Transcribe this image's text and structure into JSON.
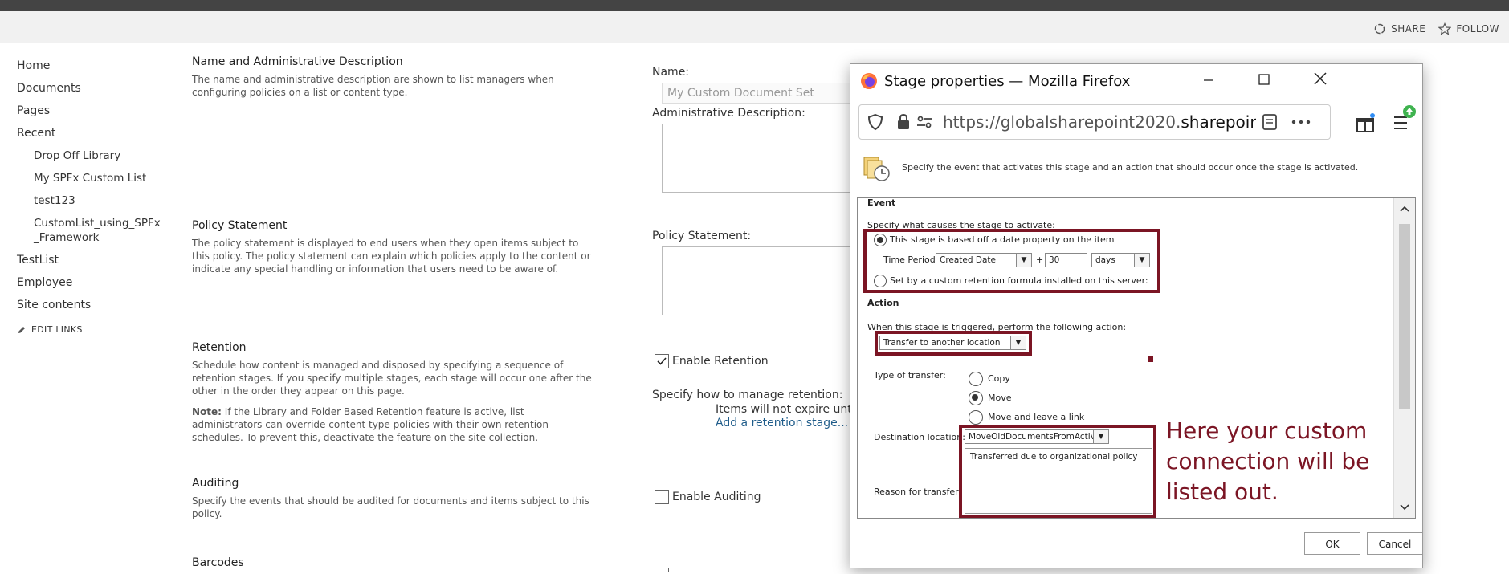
{
  "ribbon": {
    "share": "SHARE",
    "follow": "FOLLOW"
  },
  "nav": {
    "items": [
      "Home",
      "Documents",
      "Pages",
      "Recent"
    ],
    "recent": [
      "Drop Off Library",
      "My SPFx Custom List",
      "test123",
      "CustomList_using_SPFx\n_Framework"
    ],
    "more": [
      "TestList",
      "Employee",
      "Site contents"
    ],
    "edit_links": "EDIT LINKS"
  },
  "sections": {
    "name": {
      "title": "Name and Administrative Description",
      "desc": "The name and administrative description are shown to list managers when configuring policies on a list or content type."
    },
    "policy": {
      "title": "Policy Statement",
      "desc": "The policy statement is displayed to end users when they open items subject to this policy. The policy statement can explain which policies apply to the content or indicate any special handling or information that users need to be aware of."
    },
    "retention": {
      "title": "Retention",
      "desc": "Schedule how content is managed and disposed by specifying a sequence of retention stages. If you specify multiple stages, each stage will occur one after the other in the order they appear on this page.",
      "note_label": "Note:",
      "note": " If the Library and Folder Based Retention feature is active, list administrators can override content type policies with their own retention schedules.  To prevent this, deactivate the feature on the site collection."
    },
    "auditing": {
      "title": "Auditing",
      "desc": "Specify the events that should be audited for documents and items subject to this policy."
    },
    "barcodes": {
      "title": "Barcodes"
    }
  },
  "form": {
    "name_label": "Name:",
    "name_value": "My Custom Document Set",
    "admin_label": "Administrative Description:",
    "policy_label": "Policy Statement:",
    "enable_retention": "Enable Retention",
    "retention_how": "Specify how to manage retention:",
    "no_expire": "Items will not expire until a",
    "add_stage": "Add a retention stage...",
    "enable_auditing": "Enable Auditing"
  },
  "dialog": {
    "title": "Stage properties — Mozilla Firefox",
    "url_prefix": "https://globalsharepoint2020.",
    "url_bold": "sharepoint.co",
    "intro": "Specify the event that activates this stage and an action that should occur once the stage is activated.",
    "event_header": "Event",
    "event_prompt": "Specify what causes the stage to activate:",
    "opt_date": "This stage is based off a date property on the item",
    "time_period_label": "Time Period:",
    "time_property": "Created Date",
    "plus": "+",
    "time_value": "30",
    "time_unit": "days",
    "opt_formula": "Set by a custom retention formula installed on this server:",
    "action_header": "Action",
    "action_prompt": "When this stage is triggered, perform the following action:",
    "action_value": "Transfer to another location",
    "transfer_type_label": "Type of transfer:",
    "transfer_copy": "Copy",
    "transfer_move": "Move",
    "transfer_link": "Move and leave a link",
    "dest_label": "Destination location:",
    "dest_value": "MoveOldDocumentsFromActiveToRC",
    "reason_label": "Reason for transfer:",
    "reason_value": "Transferred due to organizational policy",
    "ok": "OK",
    "cancel": "Cancel"
  },
  "callout": "Here your custom connection will be listed out.",
  "colors": {
    "highlight": "#7b1524",
    "topbar": "#444444",
    "link": "#1f5c8a"
  }
}
